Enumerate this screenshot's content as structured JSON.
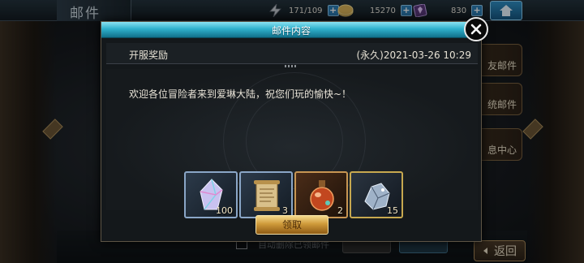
{
  "topbar": {
    "title": "邮件",
    "stamina": "171/109",
    "gold": "15270",
    "gems": "830",
    "plus_label": "+"
  },
  "side_tabs": [
    {
      "label": "友邮件"
    },
    {
      "label": "统邮件"
    },
    {
      "label": "息中心"
    }
  ],
  "background": {
    "auto_delete_label": "自动删除已领邮件",
    "back_label": "返回"
  },
  "popup": {
    "header_title": "邮件内容",
    "subject": "开服奖励",
    "date": "(永久)2021-03-26  10:29",
    "message": "欢迎各位冒险者来到爱琳大陆，祝您们玩的愉快~！",
    "claim_label": "领取",
    "rewards": [
      {
        "icon": "crystal-icon",
        "qty": "100",
        "border": "#8aa6c7"
      },
      {
        "icon": "scroll-icon",
        "qty": "3",
        "border": "#8aa6c7"
      },
      {
        "icon": "potion-icon",
        "qty": "2",
        "border": "#c79552"
      },
      {
        "icon": "silver-ore-icon",
        "qty": "15",
        "border": "#c7a84f"
      }
    ]
  },
  "colors": {
    "header_cyan": "#2fb1cc",
    "claim_gold": "#cf9a3a",
    "plus_blue": "#2d7fb5"
  }
}
